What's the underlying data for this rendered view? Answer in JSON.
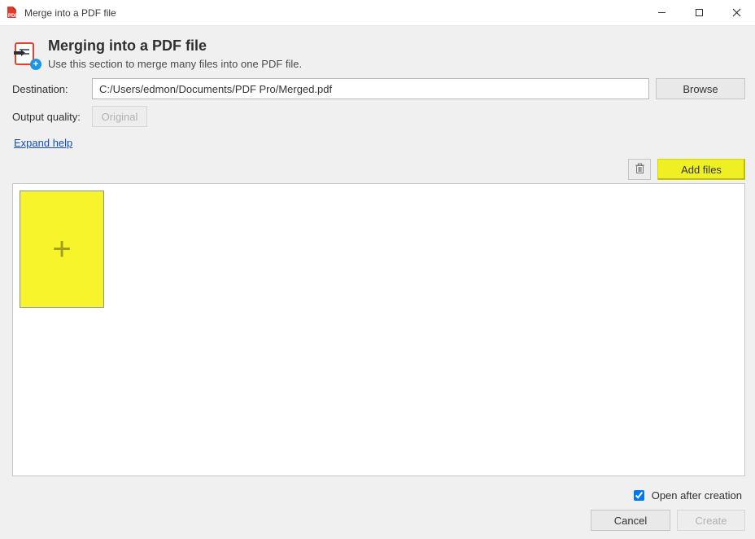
{
  "window": {
    "title": "Merge into a PDF file"
  },
  "header": {
    "title": "Merging into a PDF file",
    "subtitle": "Use this section to merge many files into one PDF file."
  },
  "form": {
    "destination_label": "Destination:",
    "destination_value": "C:/Users/edmon/Documents/PDF Pro/Merged.pdf",
    "browse_label": "Browse",
    "output_quality_label": "Output quality:",
    "output_quality_value": "Original",
    "expand_help_label": "Expand help"
  },
  "toolbar": {
    "trash_icon": "trash-icon",
    "add_files_label": "Add files"
  },
  "footer": {
    "open_after_creation_label": "Open after creation",
    "open_after_creation_checked": true,
    "cancel_label": "Cancel",
    "create_label": "Create"
  }
}
